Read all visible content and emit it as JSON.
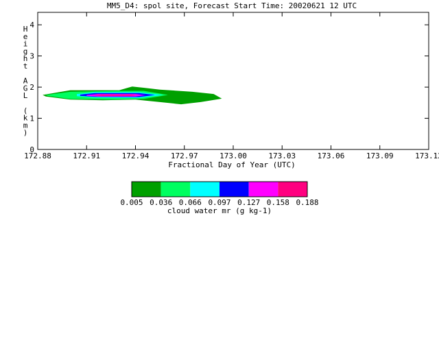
{
  "chart_data": {
    "type": "contour",
    "title": "MM5_D4: spol site,  Forecast Start Time: 20020621 12 UTC",
    "xlabel": "Fractional Day of Year (UTC)",
    "ylabel": "Height AGL (km)",
    "xlim": [
      172.88,
      173.12
    ],
    "ylim": [
      0,
      4.4
    ],
    "x_ticks": [
      172.88,
      172.91,
      172.94,
      172.97,
      173.0,
      173.03,
      173.06,
      173.09,
      173.12
    ],
    "x_tick_labels": [
      "172.88",
      "172.91",
      "172.94",
      "172.97",
      "173.00",
      "173.03",
      "173.06",
      "173.09",
      "173.12"
    ],
    "y_ticks": [
      0,
      1,
      2,
      3,
      4
    ],
    "y_tick_labels": [
      "0",
      "1",
      "2",
      "3",
      "4"
    ],
    "contour_levels": [
      {
        "level": 0.005,
        "label": "0.005",
        "color": "#00a000"
      },
      {
        "level": 0.036,
        "label": "0.036",
        "color": "#00ff60"
      },
      {
        "level": 0.066,
        "label": "0.066",
        "color": "#00ffff"
      },
      {
        "level": 0.097,
        "label": "0.097",
        "color": "#0000ff"
      },
      {
        "level": 0.127,
        "label": "0.127",
        "color": "#ff00ff"
      },
      {
        "level": 0.158,
        "label": "0.158",
        "color": "#ff0080"
      }
    ],
    "colorbar_end_label": "0.188",
    "colorbar_label": "cloud water mr (g kg-1)",
    "regions": [
      {
        "level_index": 0,
        "points": [
          [
            172.883,
            1.75
          ],
          [
            172.9,
            1.9
          ],
          [
            172.93,
            1.9
          ],
          [
            172.938,
            2.02
          ],
          [
            172.945,
            1.98
          ],
          [
            172.955,
            1.92
          ],
          [
            172.975,
            1.85
          ],
          [
            172.988,
            1.78
          ],
          [
            172.993,
            1.63
          ],
          [
            172.98,
            1.52
          ],
          [
            172.968,
            1.45
          ],
          [
            172.955,
            1.52
          ],
          [
            172.94,
            1.6
          ],
          [
            172.92,
            1.58
          ],
          [
            172.9,
            1.6
          ],
          [
            172.885,
            1.7
          ]
        ]
      },
      {
        "level_index": 1,
        "points": [
          [
            172.885,
            1.75
          ],
          [
            172.9,
            1.85
          ],
          [
            172.93,
            1.88
          ],
          [
            172.945,
            1.88
          ],
          [
            172.96,
            1.75
          ],
          [
            172.945,
            1.62
          ],
          [
            172.925,
            1.6
          ],
          [
            172.9,
            1.62
          ],
          [
            172.886,
            1.72
          ]
        ]
      },
      {
        "level_index": 2,
        "points": [
          [
            172.904,
            1.78
          ],
          [
            172.915,
            1.84
          ],
          [
            172.942,
            1.84
          ],
          [
            172.957,
            1.75
          ],
          [
            172.942,
            1.65
          ],
          [
            172.915,
            1.66
          ],
          [
            172.904,
            1.71
          ]
        ]
      },
      {
        "level_index": 3,
        "points": [
          [
            172.906,
            1.76
          ],
          [
            172.915,
            1.81
          ],
          [
            172.942,
            1.81
          ],
          [
            172.952,
            1.75
          ],
          [
            172.942,
            1.68
          ],
          [
            172.915,
            1.69
          ],
          [
            172.906,
            1.72
          ]
        ]
      },
      {
        "level_index": 4,
        "points": [
          [
            172.91,
            1.75
          ],
          [
            172.917,
            1.78
          ],
          [
            172.94,
            1.78
          ],
          [
            172.946,
            1.74
          ],
          [
            172.94,
            1.7
          ],
          [
            172.917,
            1.7
          ],
          [
            172.91,
            1.72
          ]
        ]
      },
      {
        "level_index": 5,
        "points": [
          [
            172.914,
            1.74
          ],
          [
            172.919,
            1.76
          ],
          [
            172.937,
            1.76
          ],
          [
            172.941,
            1.74
          ],
          [
            172.937,
            1.72
          ],
          [
            172.919,
            1.72
          ]
        ]
      }
    ]
  }
}
